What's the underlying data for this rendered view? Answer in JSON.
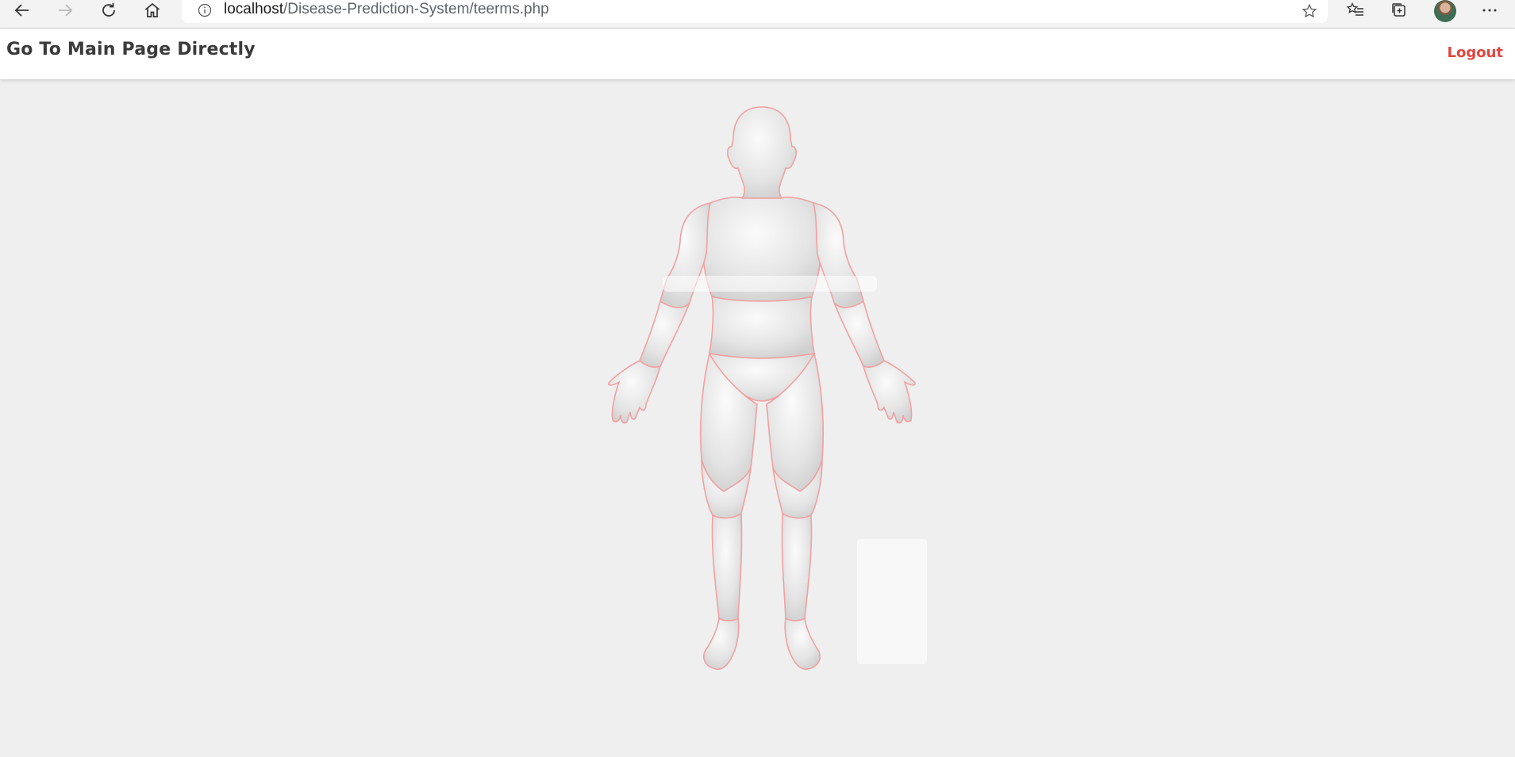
{
  "browser": {
    "url_host": "localhost",
    "url_path": "/Disease-Prediction-System/teerms.php",
    "icons": {
      "back": "back-arrow-icon",
      "forward": "forward-arrow-icon",
      "refresh": "refresh-icon",
      "home": "home-icon",
      "info": "info-icon",
      "favorite": "star-icon",
      "favorites_list": "favorites-list-icon",
      "collections": "collections-icon",
      "profile": "avatar",
      "menu": "more-options-icon"
    }
  },
  "header": {
    "brand_label": "Go To Main Page Directly",
    "logout_label": "Logout"
  },
  "colors": {
    "page_background": "#efefef",
    "header_background": "#ffffff",
    "brand_text": "#3b3b3b",
    "logout_text": "#e0463f",
    "region_outline": "#f2a0a0"
  }
}
